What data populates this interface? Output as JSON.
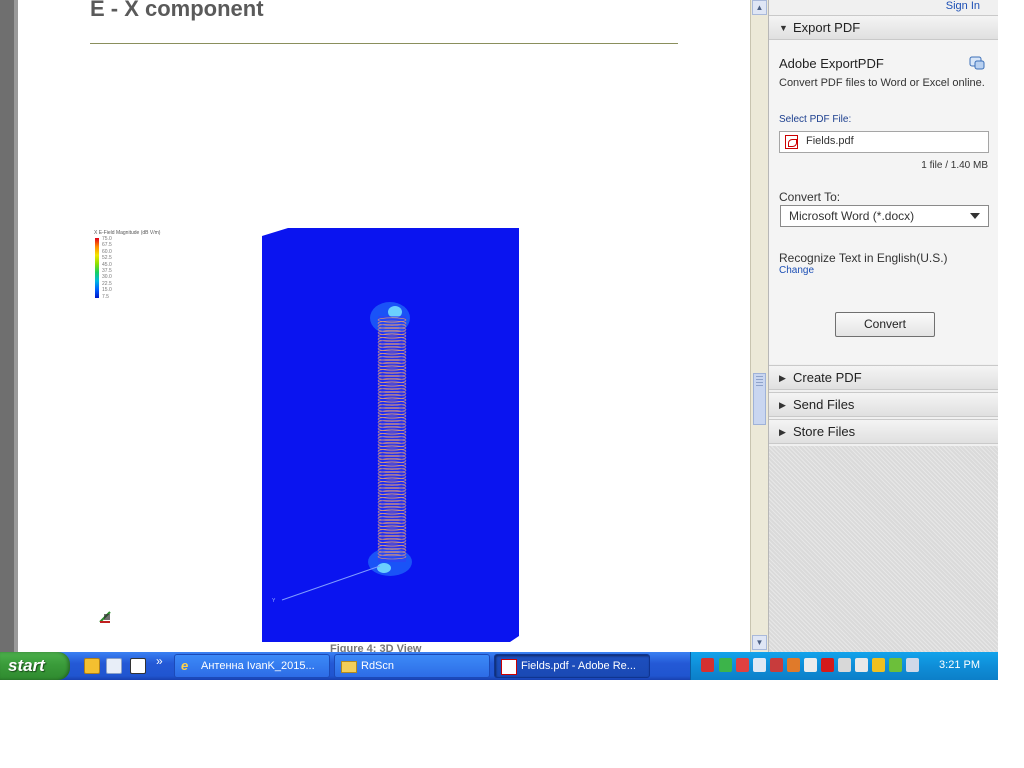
{
  "document": {
    "heading": "E - X component",
    "legend_title": "X E-Field Magnitude (dB V/m)",
    "legend_values": [
      "75.0",
      "67.5",
      "60.0",
      "52.5",
      "45.0",
      "37.5",
      "30.0",
      "22.5",
      "15.0",
      "7.5"
    ],
    "axis_y_label": "Y",
    "figure_caption": "Figure 4: 3D View"
  },
  "scrollbar": {
    "up_arrow": "▲",
    "down_arrow": "▼"
  },
  "right_pane": {
    "sign_in": "Sign In",
    "export_pdf": {
      "header": "Export PDF",
      "title": "Adobe ExportPDF",
      "subtitle": "Convert PDF files to Word or Excel online.",
      "select_label": "Select PDF File:",
      "file_name": "Fields.pdf",
      "file_size": "1 file / 1.40 MB",
      "convert_to_label": "Convert To:",
      "convert_to_value": "Microsoft Word (*.docx)",
      "recognize_text": "Recognize Text in English(U.S.)",
      "change_link": "Change",
      "convert_button": "Convert"
    },
    "sections": [
      {
        "label": "Create PDF"
      },
      {
        "label": "Send Files"
      },
      {
        "label": "Store Files"
      }
    ]
  },
  "taskbar": {
    "start_label": "start",
    "overflow": "»",
    "tasks": [
      {
        "label": "Антенна IvanK_2015...",
        "icon": "ie-icon"
      },
      {
        "label": "RdScn",
        "icon": "folder-icon"
      },
      {
        "label": "Fields.pdf - Adobe Re...",
        "icon": "pdf-icon",
        "active": true
      }
    ],
    "clock": "3:21 PM"
  },
  "colors": {
    "figure_background": "#0a14f0",
    "taskbar_blue": "#2459d6",
    "start_green": "#3a9b3a",
    "tray_blue": "#0f8ed8"
  }
}
